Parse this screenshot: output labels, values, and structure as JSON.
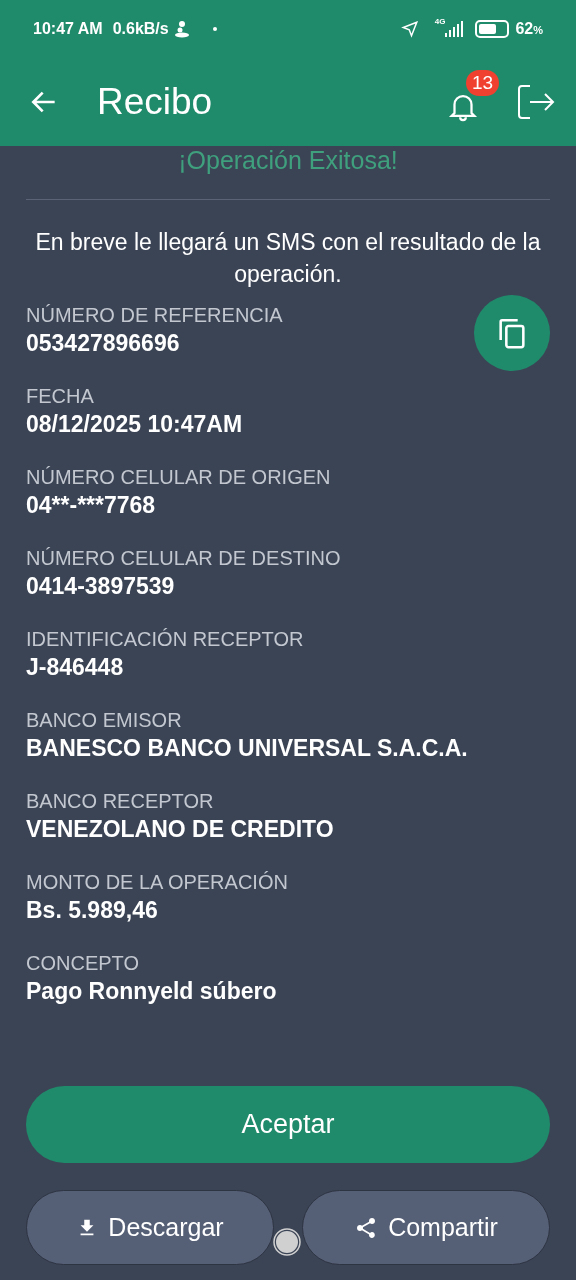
{
  "status_bar": {
    "time": "10:47 AM",
    "speed": "0.6kB/s",
    "network": "4G",
    "battery": "62",
    "battery_unit": "%"
  },
  "header": {
    "title": "Recibo",
    "notifications": "13"
  },
  "result_title": "¡Operación Exitosa!",
  "message": "En breve le llegará un SMS con el resultado de la operación.",
  "fields": [
    {
      "label": "NÚMERO DE REFERENCIA",
      "value": "053427896696"
    },
    {
      "label": "FECHA",
      "value": "08/12/2025 10:47AM"
    },
    {
      "label": "NÚMERO CELULAR DE ORIGEN",
      "value": "04**-***7768"
    },
    {
      "label": "NÚMERO CELULAR DE DESTINO",
      "value": "0414-3897539"
    },
    {
      "label": "IDENTIFICACIÓN RECEPTOR",
      "value": "J-846448"
    },
    {
      "label": "BANCO EMISOR",
      "value": "BANESCO BANCO UNIVERSAL S.A.C.A."
    },
    {
      "label": "BANCO RECEPTOR",
      "value": "VENEZOLANO DE CREDITO"
    },
    {
      "label": "MONTO DE LA OPERACIÓN",
      "value": "Bs. 5.989,46"
    },
    {
      "label": "CONCEPTO",
      "value": "Pago Ronnyeld súbero"
    }
  ],
  "primary_button": "Aceptar",
  "secondary_buttons": [
    {
      "kind": "download",
      "label": "Descargar"
    },
    {
      "kind": "share",
      "label": "Compartir"
    }
  ]
}
